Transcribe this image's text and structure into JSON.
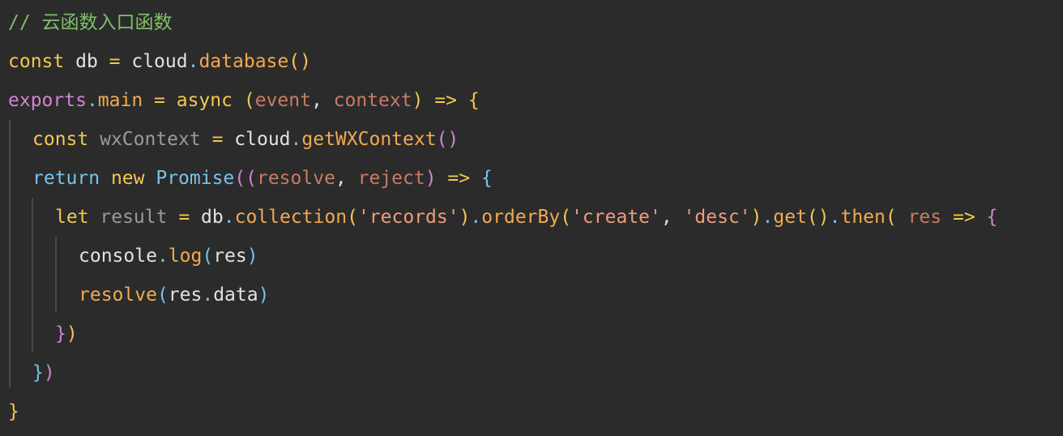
{
  "editor": {
    "lines": [
      [
        {
          "text": "// 云函数入口函数",
          "kind": "comment"
        }
      ],
      [
        {
          "text": "const",
          "kind": "keyword"
        },
        {
          "text": " db ",
          "kind": "plain"
        },
        {
          "text": "=",
          "kind": "operator"
        },
        {
          "text": " cloud",
          "kind": "plain"
        },
        {
          "text": ".",
          "kind": "blue"
        },
        {
          "text": "database",
          "kind": "function"
        },
        {
          "text": "()",
          "kind": "keyword"
        }
      ],
      [
        {
          "text": "exports",
          "kind": "purple"
        },
        {
          "text": ".",
          "kind": "blue"
        },
        {
          "text": "main",
          "kind": "function"
        },
        {
          "text": " = ",
          "kind": "operator"
        },
        {
          "text": "async",
          "kind": "keyword"
        },
        {
          "text": " (",
          "kind": "keyword"
        },
        {
          "text": "event",
          "kind": "param"
        },
        {
          "text": ", ",
          "kind": "plain"
        },
        {
          "text": "context",
          "kind": "param"
        },
        {
          "text": ") ",
          "kind": "keyword"
        },
        {
          "text": "=>",
          "kind": "operator"
        },
        {
          "text": " {",
          "kind": "keyword"
        }
      ],
      [
        {
          "text": "const",
          "kind": "keyword"
        },
        {
          "text": " wxContext ",
          "kind": "dim"
        },
        {
          "text": "=",
          "kind": "operator"
        },
        {
          "text": " cloud",
          "kind": "plain"
        },
        {
          "text": ".",
          "kind": "blue"
        },
        {
          "text": "getWXContext",
          "kind": "function"
        },
        {
          "text": "()",
          "kind": "purple"
        }
      ],
      [
        {
          "text": "return",
          "kind": "blue"
        },
        {
          "text": " new ",
          "kind": "keyword"
        },
        {
          "text": "Promise",
          "kind": "blue"
        },
        {
          "text": "((",
          "kind": "purple"
        },
        {
          "text": "resolve",
          "kind": "param"
        },
        {
          "text": ", ",
          "kind": "plain"
        },
        {
          "text": "reject",
          "kind": "param"
        },
        {
          "text": ") ",
          "kind": "purple"
        },
        {
          "text": "=>",
          "kind": "operator"
        },
        {
          "text": " {",
          "kind": "blue"
        }
      ],
      [
        {
          "text": "let",
          "kind": "keyword"
        },
        {
          "text": " result ",
          "kind": "dim"
        },
        {
          "text": "=",
          "kind": "operator"
        },
        {
          "text": " db",
          "kind": "plain"
        },
        {
          "text": ".",
          "kind": "blue"
        },
        {
          "text": "collection",
          "kind": "function"
        },
        {
          "text": "(",
          "kind": "keyword"
        },
        {
          "text": "'records'",
          "kind": "string"
        },
        {
          "text": ")",
          "kind": "keyword"
        },
        {
          "text": ".",
          "kind": "blue"
        },
        {
          "text": "orderBy",
          "kind": "function"
        },
        {
          "text": "(",
          "kind": "keyword"
        },
        {
          "text": "'create'",
          "kind": "string"
        },
        {
          "text": ", ",
          "kind": "plain"
        },
        {
          "text": "'desc'",
          "kind": "string"
        },
        {
          "text": ")",
          "kind": "keyword"
        },
        {
          "text": ".",
          "kind": "blue"
        },
        {
          "text": "get",
          "kind": "function"
        },
        {
          "text": "()",
          "kind": "keyword"
        },
        {
          "text": ".",
          "kind": "blue"
        },
        {
          "text": "then",
          "kind": "function"
        },
        {
          "text": "( ",
          "kind": "keyword"
        },
        {
          "text": "res",
          "kind": "param"
        },
        {
          "text": " => ",
          "kind": "operator"
        },
        {
          "text": "{",
          "kind": "purple"
        }
      ],
      [
        {
          "text": "console",
          "kind": "plain"
        },
        {
          "text": ".",
          "kind": "blue"
        },
        {
          "text": "log",
          "kind": "function"
        },
        {
          "text": "(",
          "kind": "blue"
        },
        {
          "text": "res",
          "kind": "plain"
        },
        {
          "text": ")",
          "kind": "blue"
        }
      ],
      [
        {
          "text": "resolve",
          "kind": "function"
        },
        {
          "text": "(",
          "kind": "blue"
        },
        {
          "text": "res",
          "kind": "plain"
        },
        {
          "text": ".",
          "kind": "blue"
        },
        {
          "text": "data",
          "kind": "plain"
        },
        {
          "text": ")",
          "kind": "blue"
        }
      ],
      [
        {
          "text": "}",
          "kind": "purple"
        },
        {
          "text": ")",
          "kind": "keyword"
        }
      ],
      [
        {
          "text": "}",
          "kind": "blue"
        },
        {
          "text": ")",
          "kind": "purple"
        }
      ],
      [
        {
          "text": "}",
          "kind": "keyword"
        }
      ]
    ],
    "colors": {
      "background": "#2b2b2b",
      "comment": "#7fc06a",
      "keyword": "#f3c74f",
      "function": "#f3a94f",
      "param": "#c87b64",
      "string": "#f09b7b",
      "blue": "#78c2ea",
      "purple": "#d283d4",
      "plain": "#e2e2e2",
      "dim": "#9a9a9a"
    }
  }
}
